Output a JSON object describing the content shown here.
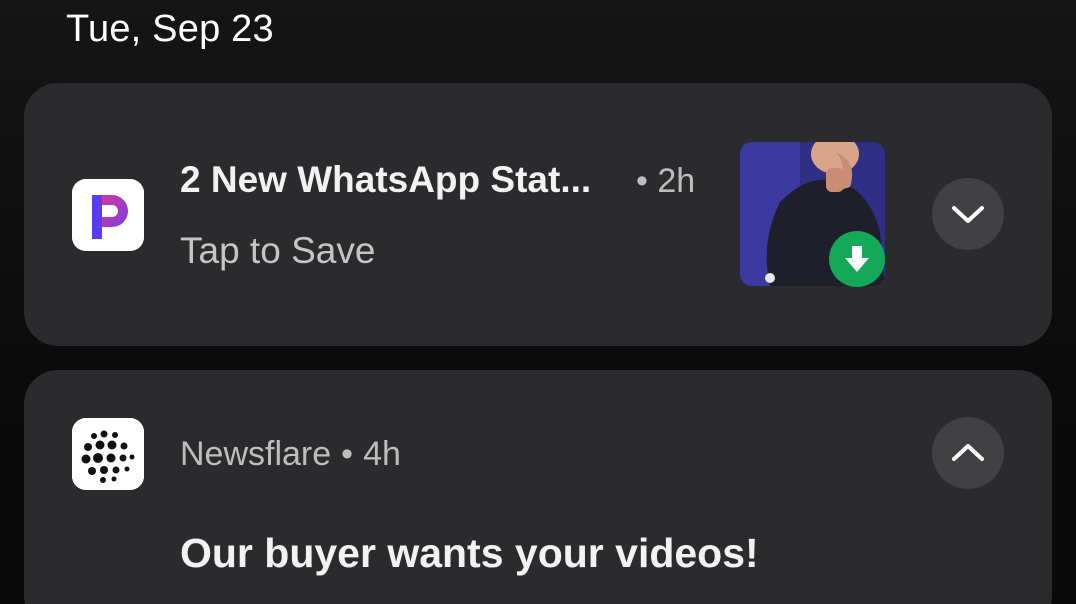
{
  "date": "Tue, Sep 23",
  "notifications": [
    {
      "app_icon": "p-logo-icon",
      "title": "2 New WhatsApp Stat...",
      "separator": "•",
      "time": "2h",
      "subtitle": "Tap to Save",
      "thumbnail": "person-photo-thumbnail",
      "badge_icon": "download-arrow-icon",
      "badge_color": "#14a958",
      "expand_icon": "chevron-down-icon"
    },
    {
      "app_icon": "newsflare-dots-icon",
      "app_name": "Newsflare",
      "separator": "•",
      "time": "4h",
      "message": "Our buyer wants your videos!",
      "expand_icon": "chevron-up-icon"
    }
  ],
  "colors": {
    "card_background": "#2b2b2d",
    "button_background": "#414144",
    "accent_purple": "#6c3cf0",
    "accent_pink": "#e23a8c"
  }
}
